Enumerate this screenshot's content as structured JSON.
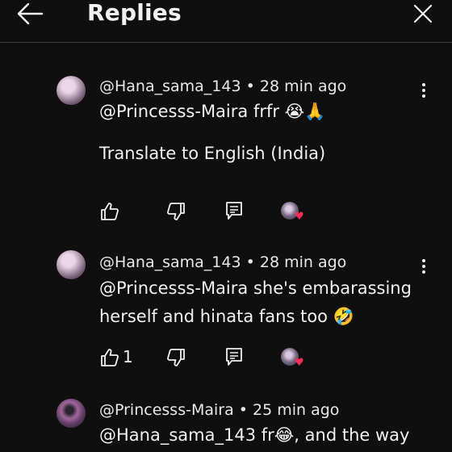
{
  "header": {
    "title": "Replies"
  },
  "replies": [
    {
      "meta": "@Hana_sama_143 • 28 min ago",
      "text_line1": " @Princesss-Maira  frfr 😭🙏",
      "translate": "Translate to English (India)",
      "like_count": ""
    },
    {
      "meta": "@Hana_sama_143 • 28 min ago",
      "text_line1": " @Princesss-Maira  she's embarassing",
      "text_line2": "herself and hinata fans too 🤣",
      "like_count": "1"
    },
    {
      "meta": "@Princesss-Maira • 25 min ago",
      "text_line1": " @Hana_sama_143  fr😂, and the way"
    }
  ]
}
